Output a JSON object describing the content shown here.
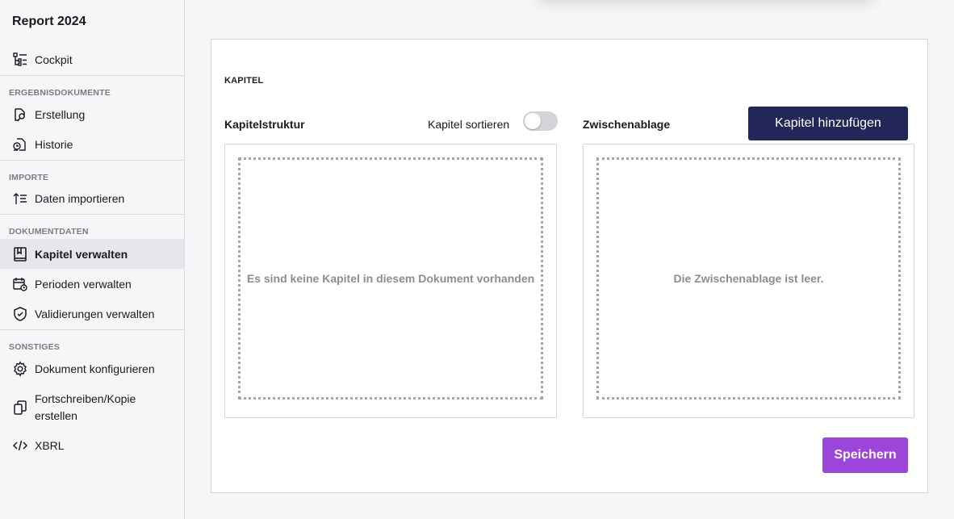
{
  "sidebar": {
    "title": "Report 2024",
    "cockpit": {
      "label": "Cockpit",
      "icon": "tree-structure-icon"
    },
    "sections": {
      "ergebnis": "ERGEBNISDOKUMENTE",
      "importe": "IMPORTE",
      "dokumentdaten": "DOKUMENTDATEN",
      "sonstiges": "SONSTIGES"
    },
    "items": {
      "erstellung": {
        "label": "Erstellung",
        "icon": "document-pen-icon"
      },
      "historie": {
        "label": "Historie",
        "icon": "document-history-icon"
      },
      "daten_importieren": {
        "label": "Daten importieren",
        "icon": "import-list-icon"
      },
      "kapitel_verwalten": {
        "label": "Kapitel verwalten",
        "icon": "book-icon"
      },
      "perioden_verwalten": {
        "label": "Perioden verwalten",
        "icon": "calendar-clock-icon"
      },
      "validierungen_verwalten": {
        "label": "Validierungen verwalten",
        "icon": "shield-check-icon"
      },
      "dokument_konfigurieren": {
        "label": "Dokument konfigurieren",
        "icon": "gear-icon"
      },
      "fortschreiben": {
        "label_line1": "Fortschreiben/Kopie",
        "label_line2": "erstellen",
        "icon": "copy-icon"
      },
      "xbrl": {
        "label": "XBRL",
        "icon": "code-icon"
      }
    },
    "active_item": "kapitel_verwalten"
  },
  "main": {
    "heading": "KAPITEL",
    "structure": {
      "title": "Kapitelstruktur",
      "sort_label": "Kapitel sortieren",
      "sort_enabled": false,
      "empty_text": "Es sind keine Kapitel in diesem Dokument vorhanden"
    },
    "clipboard": {
      "title": "Zwischenablage",
      "empty_text": "Die Zwischenablage ist leer."
    },
    "add_button": "Kapitel hinzufügen",
    "save_button": "Speichern"
  },
  "colors": {
    "primary": "#232659",
    "save": "#9b45d9",
    "active_bg": "#e6e7ea"
  }
}
